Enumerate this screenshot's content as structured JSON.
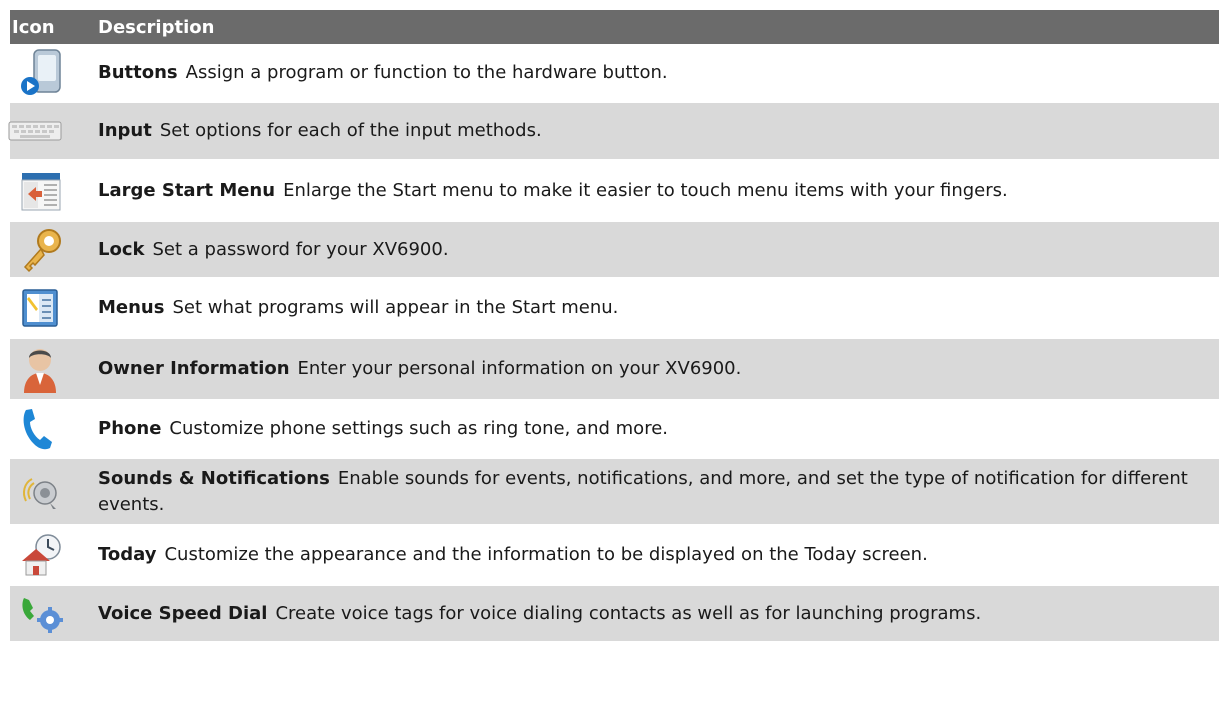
{
  "header": {
    "icon_label": "Icon",
    "description_label": "Description"
  },
  "rows": [
    {
      "icon": "buttons-icon",
      "name": "Buttons",
      "desc": "Assign a program or function to the hardware button."
    },
    {
      "icon": "keyboard-icon",
      "name": "Input",
      "desc": "Set options for each of the input methods."
    },
    {
      "icon": "start-menu-icon",
      "name": "Large Start Menu",
      "desc": "Enlarge the Start menu to make it easier to touch menu items with your fingers."
    },
    {
      "icon": "key-icon",
      "name": "Lock",
      "desc": "Set a password for your XV6900."
    },
    {
      "icon": "menus-icon",
      "name": "Menus",
      "desc": "Set what programs will appear in the Start menu."
    },
    {
      "icon": "owner-icon",
      "name": "Owner Information",
      "desc": "Enter your personal information on your XV6900."
    },
    {
      "icon": "phone-icon",
      "name": "Phone",
      "desc": "Customize phone settings such as ring tone, and more."
    },
    {
      "icon": "sound-icon",
      "name": "Sounds & Notifications",
      "desc": "Enable sounds for events, notifications, and more, and set the type of notification for different events."
    },
    {
      "icon": "today-icon",
      "name": "Today",
      "desc": "Customize the appearance and the information to be displayed on the Today screen."
    },
    {
      "icon": "voice-dial-icon",
      "name": "Voice Speed Dial",
      "desc": "Create voice tags for voice dialing contacts as well as for launching programs."
    }
  ]
}
